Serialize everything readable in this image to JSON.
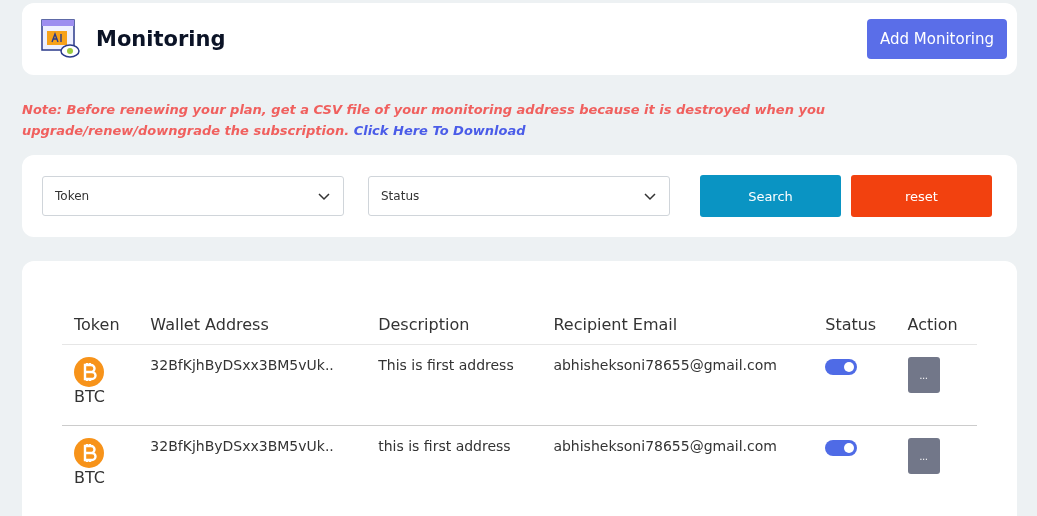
{
  "header": {
    "title": "Monitoring",
    "add_button": "Add Monitoring"
  },
  "note": {
    "text": "Note: Before renewing your plan, get a CSV file of your monitoring address because it is destroyed when you upgrade/renew/downgrade the subscription.",
    "link": "Click Here To Download"
  },
  "filters": {
    "dropdowns": [
      "Token",
      "Status"
    ],
    "search_button": "Search",
    "reset_button": "reset"
  },
  "table": {
    "columns": [
      "Token",
      "Wallet Address",
      "Description",
      "Recipient Email",
      "Status",
      "Action"
    ],
    "rows": [
      {
        "token": "BTC",
        "wallet": "32BfKjhByDSxx3BM5vUk..",
        "description": "This is first address",
        "email": "abhisheksoni78655@gmail.com",
        "on": true,
        "action": "..."
      },
      {
        "token": "BTC",
        "wallet": "32BfKjhByDSxx3BM5vUk..",
        "description": "this is first address",
        "email": "abhisheksoni78655@gmail.com",
        "on": true,
        "action": "..."
      }
    ]
  }
}
